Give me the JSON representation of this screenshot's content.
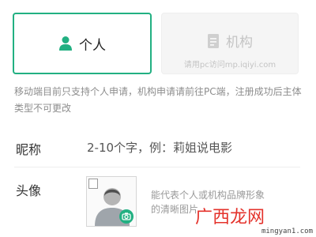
{
  "account_type": {
    "personal": {
      "label": "个人",
      "icon": "user-icon",
      "selected": true
    },
    "organization": {
      "label": "机构",
      "icon": "document-icon",
      "note": "请用pc访问mp.iqiyi.com"
    }
  },
  "notice": "移动端目前只支持个人申请，机构申请请前往PC端，注册成功后主体类型不可更改",
  "nickname": {
    "label": "昵称",
    "placeholder": "2-10个字，例：莉姐说电影"
  },
  "avatar": {
    "label": "头像",
    "hint": "能代表个人或机构品牌形象的清晰图片"
  },
  "watermark": {
    "brand": "广西龙网",
    "url": "mingyan1.com"
  },
  "colors": {
    "accent": "#22b082",
    "muted": "#c4c4c4",
    "watermark_red": "#e4322b"
  }
}
